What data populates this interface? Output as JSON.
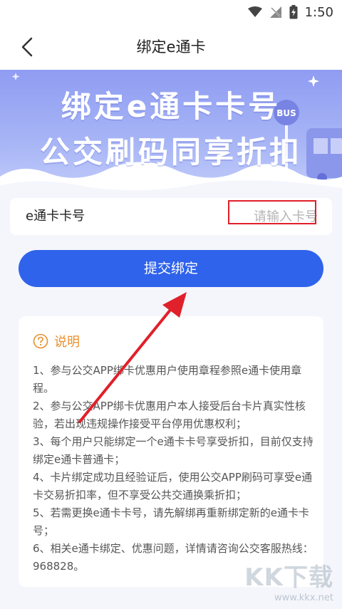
{
  "status_bar": {
    "time": "1:50"
  },
  "nav": {
    "title": "绑定e通卡",
    "back_icon": "chevron-left-icon"
  },
  "banner": {
    "line1": "绑定e通卡卡号",
    "line2": "公交刷码同享折扣",
    "bus_sign": "BUS"
  },
  "form": {
    "label": "e通卡卡号",
    "placeholder": "请输入卡号",
    "value": ""
  },
  "submit": {
    "label": "提交绑定"
  },
  "info": {
    "icon": "question-circle-icon",
    "title": "说明",
    "items": [
      "1、参与公交APP绑卡优惠用户使用章程参照e通卡使用章程。",
      "2、参与公交APP绑卡优惠用户本人接受后台卡片真实性核验，若出现违规操作接受平台停用优惠权利；",
      "3、每个用户只能绑定一个e通卡卡号享受折扣，目前仅支持绑定e通卡普通卡；",
      "4、卡片绑定成功且经验证后，使用公交APP刷码可享受e通卡交易折扣率，但不享受公共交通换乘折扣；",
      "5、若需更换e通卡卡号，请先解绑再重新绑定新的e通卡卡号；",
      "6、相关e通卡绑定、优惠问题，详情请咨询公交客服热线：968828。"
    ]
  },
  "watermark": {
    "logo": "KK下载",
    "url": "www.kkx.net"
  },
  "colors": {
    "primary": "#2f63eb",
    "accent": "#e8902c",
    "highlight": "#e0202a",
    "banner": "#9aa8f4"
  }
}
